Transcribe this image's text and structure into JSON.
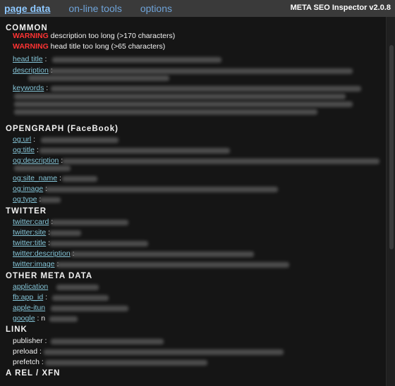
{
  "topbar": {
    "tabs": [
      "page data",
      "on-line tools",
      "options"
    ],
    "active_tab": 0,
    "brand": "META SEO Inspector v2.0.8"
  },
  "sections": {
    "common": "COMMON",
    "opengraph": "OPENGRAPH (FaceBook)",
    "twitter": "TWITTER",
    "other": "OTHER META DATA",
    "link": "LINK",
    "arel": "A REL / XFN"
  },
  "common": {
    "warning_word": "WARNING",
    "warning_1": "description too long (>170 characters)",
    "warning_2": "head title too long (>65 characters)",
    "head_title": "head title",
    "description": "description",
    "keywords": "keywords"
  },
  "opengraph": [
    "og:url",
    "og:title",
    "og:description",
    "og:site_name",
    "og:image",
    "og:type"
  ],
  "twitter": [
    "twitter:card",
    "twitter:site",
    "twitter:title",
    "twitter:description",
    "twitter:image"
  ],
  "other": {
    "application": "application",
    "fb_app_id": "fb:app_id",
    "apple_itunes": "apple-itun",
    "google": "google",
    "google_value": "n"
  },
  "link": [
    "publisher",
    "preload",
    "prefetch"
  ]
}
